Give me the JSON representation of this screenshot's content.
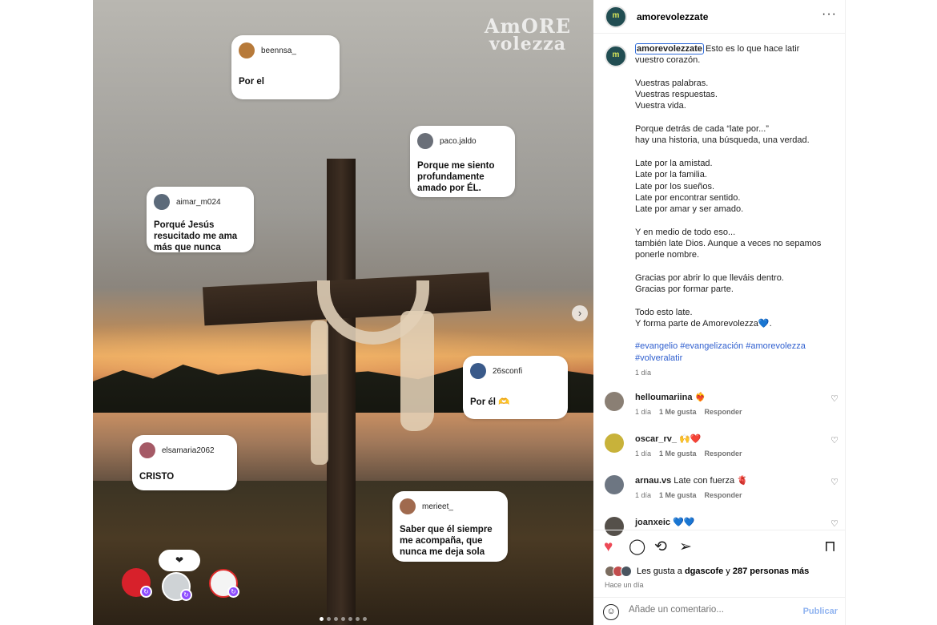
{
  "post": {
    "brand_logo": [
      "AmORE",
      "volezza"
    ],
    "cards": [
      {
        "user": "beennsa_",
        "text": [
          "Por el"
        ],
        "color": "#b77a3a"
      },
      {
        "user": "paco.jaldo",
        "text": [
          "Porque me siento",
          "profundamente",
          "amado por ÉL."
        ],
        "color": "#6a6f78"
      },
      {
        "user": "aimar_m024",
        "text": [
          "Porqué Jesús",
          "resucitado me ama",
          "más que nunca"
        ],
        "color": "#5c6a7a"
      },
      {
        "user": "26sconfi",
        "text": [
          "Por él 🫶"
        ],
        "color": "#3a5a8a"
      },
      {
        "user": "elsamaria2062",
        "text": [
          "CRISTO"
        ],
        "color": "#a55a66"
      },
      {
        "user": "merieet_",
        "text": [
          "Saber que él siempre",
          "me acompaña, que",
          "nunca me deja sola"
        ],
        "color": "#a06a4e"
      }
    ],
    "reply_pill": "❤",
    "next_arrow": "›",
    "slide_count": 7,
    "current_slide": 0
  },
  "panel": {
    "username": "amorevolezzate",
    "logo_text": "m",
    "more": "···",
    "caption": {
      "first_line": "Esto es lo que hace latir",
      "lines": [
        "vuestro corazón.",
        "",
        "Vuestras palabras.",
        "Vuestras respuestas.",
        "Vuestra vida.",
        "",
        "Porque detrás de cada “late por...”",
        "hay una historia, una búsqueda, una verdad.",
        "",
        "Late por la amistad.",
        "Late por la familia.",
        "Late por los sueños.",
        "Late por encontrar sentido.",
        "Late por amar y ser amado.",
        "",
        "Y en medio de todo eso...",
        "también late Dios. Aunque a veces no sepamos",
        "ponerle nombre.",
        "",
        "Gracias por abrir lo que lleváis dentro.",
        "Gracias por formar parte.",
        "",
        "Todo esto late.",
        "Y forma parte de Amorevolezza💙."
      ],
      "hashtags": [
        "#evangelio #evangelización #amorevolezza",
        "#volveralatir"
      ],
      "time": "1 día"
    },
    "comments": [
      {
        "user": "helloumariina",
        "text": "❤️‍🔥",
        "time": "1 día",
        "likes": "1 Me gusta",
        "reply": "Responder",
        "color": "#8a7f74"
      },
      {
        "user": "oscar_rv_",
        "text": "🙌❤️",
        "time": "1 día",
        "likes": "1 Me gusta",
        "reply": "Responder",
        "color": "#c8b23a"
      },
      {
        "user": "arnau.vs",
        "text": "Late con fuerza 🫀",
        "time": "1 día",
        "likes": "1 Me gusta",
        "reply": "Responder",
        "color": "#6d7682"
      },
      {
        "user": "joanxeic",
        "text": "💙💙",
        "time": "",
        "likes": "",
        "reply": "",
        "color": "#55504a"
      }
    ],
    "likes": {
      "prefix": "Les gusta a ",
      "name": "dgascofe",
      "mid": " y ",
      "count": "287 personas más"
    },
    "date": "Hace un día",
    "comment_placeholder": "Añade un comentario...",
    "publish": "Publicar",
    "colors": {
      "like": "#ed4956",
      "link": "#2f5fcf",
      "publish": "#8fb3f0"
    }
  }
}
